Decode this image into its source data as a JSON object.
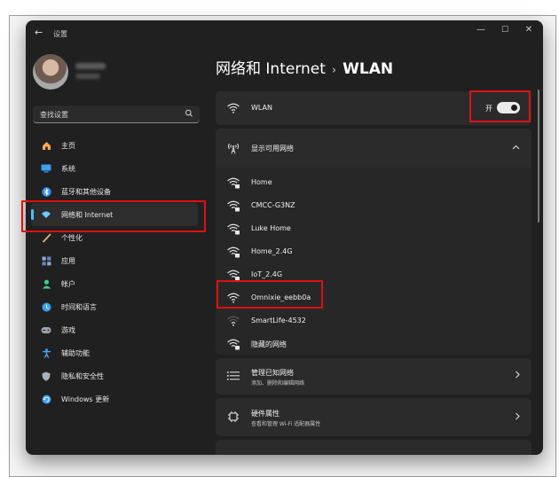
{
  "window": {
    "title": "设置",
    "back_glyph": "←",
    "min_glyph": "—",
    "max_glyph": "☐",
    "close_glyph": "✕"
  },
  "sidebar": {
    "search_placeholder": "查找设置",
    "items": [
      {
        "label": "主页",
        "icon": "home-icon",
        "color": "#f7a94b"
      },
      {
        "label": "系统",
        "icon": "system-icon",
        "color": "#3aa0f2"
      },
      {
        "label": "蓝牙和其他设备",
        "icon": "bluetooth-icon",
        "color": "#3b8df7"
      },
      {
        "label": "网络和 Internet",
        "icon": "network-icon",
        "color": "#6fc7ff",
        "active": true
      },
      {
        "label": "个性化",
        "icon": "personalization-icon",
        "color": "#e4b27a"
      },
      {
        "label": "应用",
        "icon": "apps-icon",
        "color": "#8fa8c8"
      },
      {
        "label": "帐户",
        "icon": "accounts-icon",
        "color": "#3fcf8e"
      },
      {
        "label": "时间和语言",
        "icon": "time-language-icon",
        "color": "#3aa0f2"
      },
      {
        "label": "游戏",
        "icon": "gaming-icon",
        "color": "#9aa4b0"
      },
      {
        "label": "辅助功能",
        "icon": "accessibility-icon",
        "color": "#4aa0ff"
      },
      {
        "label": "隐私和安全性",
        "icon": "privacy-shield-icon",
        "color": "#a9b0bd"
      },
      {
        "label": "Windows 更新",
        "icon": "windows-update-icon",
        "color": "#3aa0f2"
      }
    ]
  },
  "header": {
    "breadcrumb_parent": "网络和 Internet",
    "separator": "›",
    "current": "WLAN"
  },
  "wlan": {
    "label": "WLAN",
    "toggle_state_text": "开",
    "enabled": true
  },
  "networks": {
    "header": "显示可用网络",
    "expanded": true,
    "items": [
      {
        "name": "Home"
      },
      {
        "name": "CMCC-G3NZ"
      },
      {
        "name": "Luke Home"
      },
      {
        "name": "Home_2.4G"
      },
      {
        "name": "IoT_2.4G"
      },
      {
        "name": "Omnixie_eebb0a"
      },
      {
        "name": "SmartLife-4532"
      },
      {
        "name": "隐藏的网络"
      }
    ]
  },
  "manage": {
    "title": "管理已知网络",
    "subtitle": "添加、删除和编辑网络"
  },
  "hardware": {
    "title": "硬件属性",
    "subtitle": "查看和管理 Wi-Fi 适配器属性"
  },
  "colors": {
    "accent": "#4cc2ff",
    "highlight": "#e01010",
    "window_bg": "#202020",
    "card_bg": "#2b2b2b"
  }
}
